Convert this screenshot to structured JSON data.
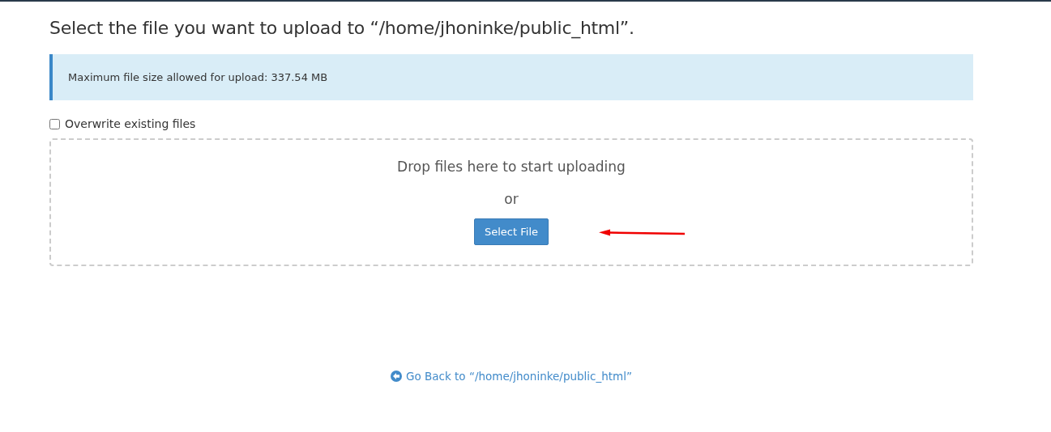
{
  "heading": "Select the file you want to upload to “/home/jhoninke/public_html”.",
  "notice": "Maximum file size allowed for upload: 337.54 MB",
  "overwrite": {
    "label": "Overwrite existing files",
    "checked": false
  },
  "dropzone": {
    "prompt": "Drop files here to start uploading",
    "separator": "or",
    "button": "Select File"
  },
  "back_link": "Go Back to “/home/jhoninke/public_html”"
}
